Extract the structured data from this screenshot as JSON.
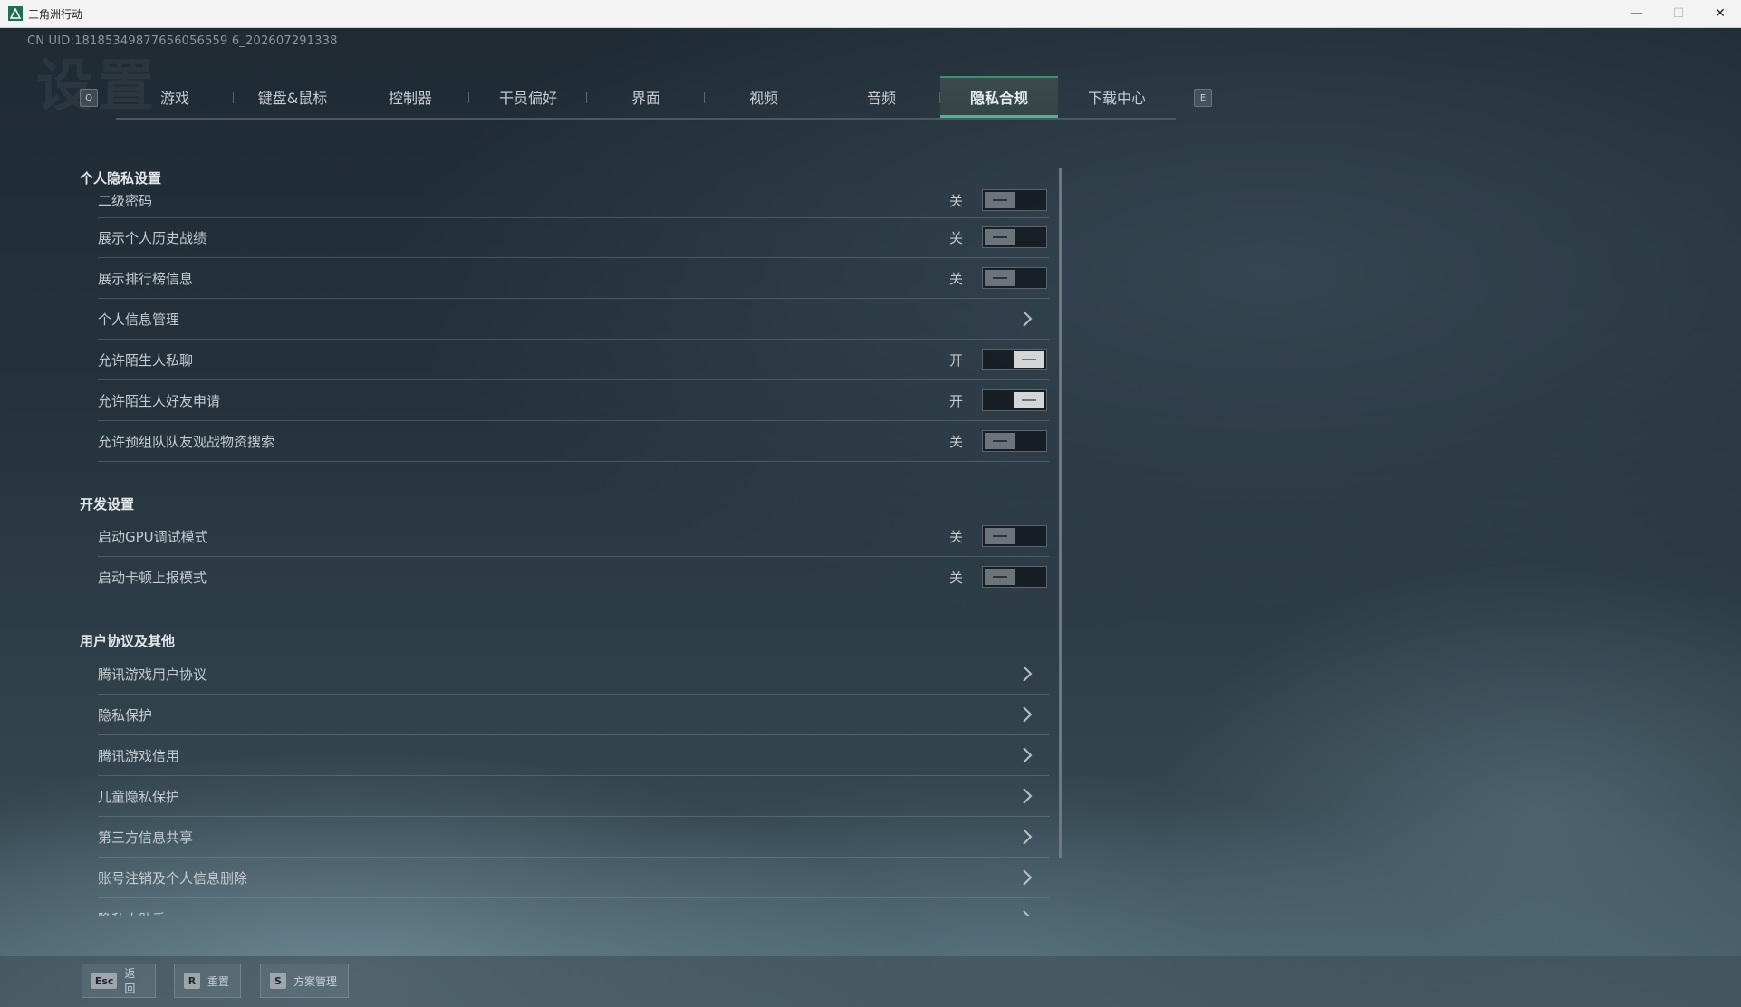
{
  "window": {
    "title": "三角洲行动",
    "minimize": "—",
    "maximize": "☐",
    "close": "✕"
  },
  "uid": "CN UID:18185349877656056559 6_202607291338",
  "watermark": "设置",
  "tabbar": {
    "left_key": "Q",
    "right_key": "E",
    "tabs": [
      {
        "label": "游戏"
      },
      {
        "label": "键盘&鼠标"
      },
      {
        "label": "控制器"
      },
      {
        "label": "干员偏好"
      },
      {
        "label": "界面"
      },
      {
        "label": "视频"
      },
      {
        "label": "音频"
      },
      {
        "label": "隐私合规",
        "active": true
      },
      {
        "label": "下载中心"
      }
    ]
  },
  "sections": {
    "personal": {
      "title": "个人隐私设置",
      "rows": [
        {
          "label": "二级密码",
          "state": "关",
          "type": "toggle",
          "on": false
        },
        {
          "label": "展示个人历史战绩",
          "state": "关",
          "type": "toggle",
          "on": false
        },
        {
          "label": "展示排行榜信息",
          "state": "关",
          "type": "toggle",
          "on": false
        },
        {
          "label": "个人信息管理",
          "type": "link"
        },
        {
          "label": "允许陌生人私聊",
          "state": "开",
          "type": "toggle",
          "on": true
        },
        {
          "label": "允许陌生人好友申请",
          "state": "开",
          "type": "toggle",
          "on": true
        },
        {
          "label": "允许预组队队友观战物资搜索",
          "state": "关",
          "type": "toggle",
          "on": false
        }
      ]
    },
    "dev": {
      "title": "开发设置",
      "rows": [
        {
          "label": "启动GPU调试模式",
          "state": "关",
          "type": "toggle",
          "on": false
        },
        {
          "label": "启动卡顿上报模式",
          "state": "关",
          "type": "toggle",
          "on": false
        }
      ]
    },
    "agreements": {
      "title": "用户协议及其他",
      "rows": [
        {
          "label": "腾讯游戏用户协议",
          "type": "link"
        },
        {
          "label": "隐私保护",
          "type": "link"
        },
        {
          "label": "腾讯游戏信用",
          "type": "link"
        },
        {
          "label": "儿童隐私保护",
          "type": "link"
        },
        {
          "label": "第三方信息共享",
          "type": "link"
        },
        {
          "label": "账号注销及个人信息删除",
          "type": "link"
        },
        {
          "label": "隐私小助手",
          "type": "link"
        }
      ]
    }
  },
  "bottombar": {
    "back": {
      "key": "Esc",
      "label": "返回"
    },
    "reset": {
      "key": "R",
      "label": "重置"
    },
    "preset": {
      "key": "S",
      "label": "方案管理"
    }
  }
}
